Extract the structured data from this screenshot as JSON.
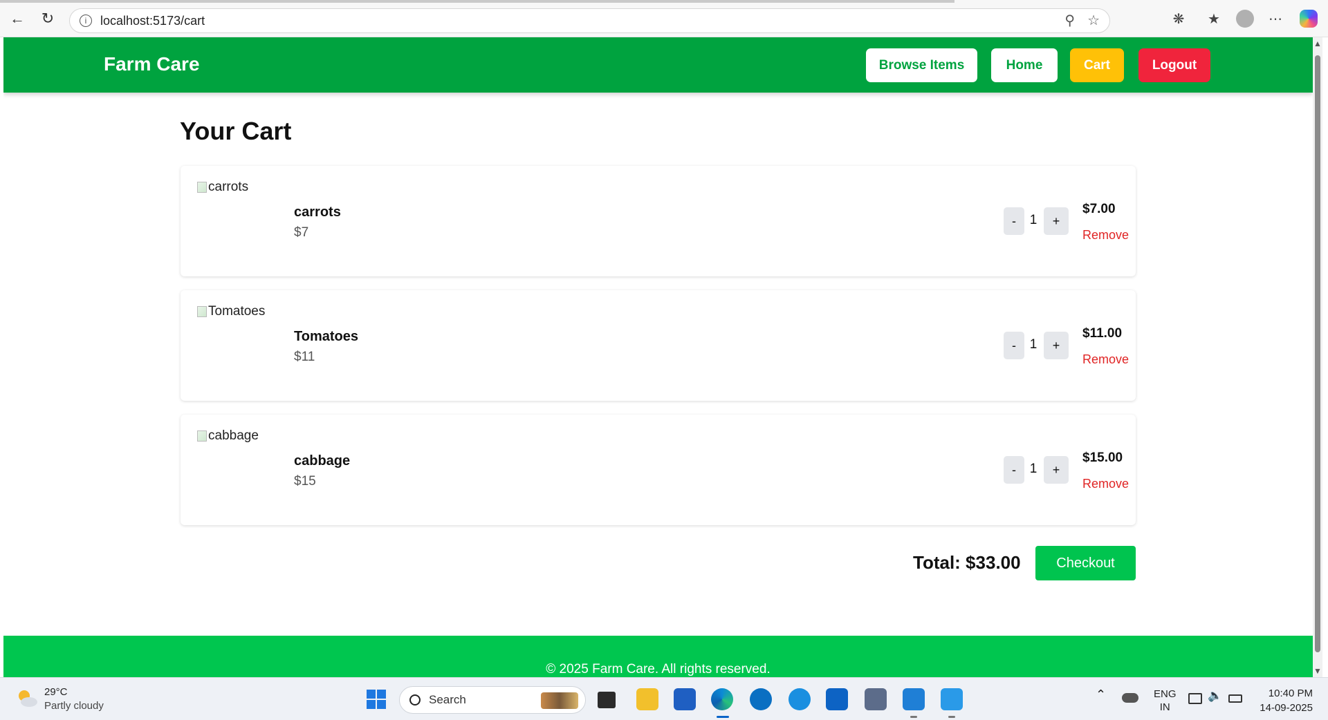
{
  "browser": {
    "url": "localhost:5173/cart"
  },
  "header": {
    "brand": "Farm Care",
    "nav": {
      "browse": "Browse Items",
      "home": "Home",
      "cart": "Cart",
      "logout": "Logout"
    },
    "colors": {
      "header_bg": "#00a33f",
      "cart_bg": "#ffc107",
      "logout_bg": "#f0243c"
    }
  },
  "cart": {
    "title": "Your Cart",
    "items": [
      {
        "image_alt": "carrots",
        "name": "carrots",
        "price": "$7",
        "quantity": "1",
        "line_total": "$7.00",
        "remove_label": "Remove",
        "minus": "-",
        "plus": "+"
      },
      {
        "image_alt": "Tomatoes",
        "name": "Tomatoes",
        "price": "$11",
        "quantity": "1",
        "line_total": "$11.00",
        "remove_label": "Remove",
        "minus": "-",
        "plus": "+"
      },
      {
        "image_alt": "cabbage",
        "name": "cabbage",
        "price": "$15",
        "quantity": "1",
        "line_total": "$15.00",
        "remove_label": "Remove",
        "minus": "-",
        "plus": "+"
      }
    ],
    "total": "Total: $33.00",
    "checkout_label": "Checkout"
  },
  "footer": {
    "text": "© 2025 Farm Care. All rights reserved."
  },
  "taskbar": {
    "weather_temp": "29°C",
    "weather_desc": "Partly cloudy",
    "search_label": "Search",
    "lang_top": "ENG",
    "lang_bottom": "IN",
    "time": "10:40 PM",
    "date": "14-09-2025"
  }
}
